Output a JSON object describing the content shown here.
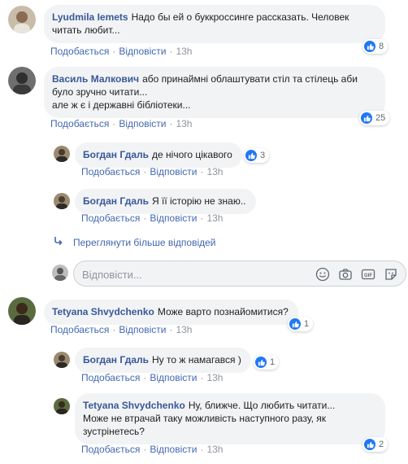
{
  "actions": {
    "like": "Подобається",
    "reply": "Відповісти"
  },
  "comments": [
    {
      "author": "Lyudmila Iemets",
      "text": "Надо бы ей о буккроссинге рассказать. Человек\nчитать любит...",
      "time": "13h",
      "reactions": "8"
    },
    {
      "author": "Василь Малкович",
      "text": "або принаймні облаштувати стіл та стілець аби\nбуло зручно читати...\nале ж є і державні бібліотеки...",
      "time": "13h",
      "reactions": "25"
    },
    {
      "author": "Богдан Гдаль",
      "text": "де нічого цікавого",
      "time": "13h",
      "reactions": "3"
    },
    {
      "author": "Богдан Гдаль",
      "text": "Я її історію не знаю..",
      "time": "13h",
      "reactions": ""
    },
    {
      "author": "Tetyana Shvydchenko",
      "text": "Може варто познайомитися?",
      "time": "13h",
      "reactions": "1"
    },
    {
      "author": "Богдан Гдаль",
      "text": "Ну то ж намагався )",
      "time": "13h",
      "reactions": "1"
    },
    {
      "author": "Tetyana Shvydchenko",
      "text": "Ну, ближче. Що любить читати...\nМоже не втрачай таку можливість наступного разу, як\nзустрінетесь?",
      "time": "13h",
      "reactions": "2"
    }
  ],
  "more_replies": "Переглянути більше відповідей",
  "reply_box": {
    "placeholder": "Відповісти..."
  },
  "icons": [
    "emoji-icon",
    "camera-icon",
    "gif-icon",
    "sticker-icon"
  ],
  "colors": {
    "link": "#4267b2",
    "author": "#385898",
    "bubble": "#f2f3f5",
    "like": "#2078f4"
  }
}
